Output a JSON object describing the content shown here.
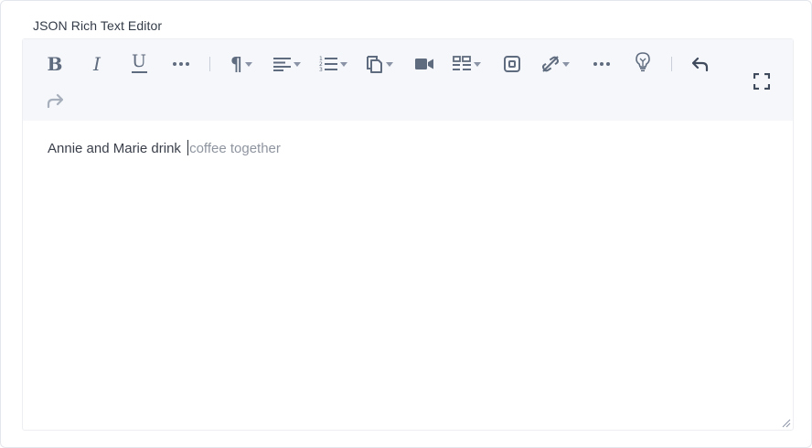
{
  "field": {
    "label": "JSON Rich Text Editor"
  },
  "toolbar": {
    "buttons": [
      {
        "name": "bold",
        "label": "B"
      },
      {
        "name": "italic",
        "label": "I"
      },
      {
        "name": "underline",
        "label": "U"
      },
      {
        "name": "more-formatting"
      },
      {
        "name": "paragraph-style"
      },
      {
        "name": "text-align"
      },
      {
        "name": "list"
      },
      {
        "name": "embed-asset"
      },
      {
        "name": "video"
      },
      {
        "name": "table"
      },
      {
        "name": "embed-block"
      },
      {
        "name": "link"
      },
      {
        "name": "more-options"
      },
      {
        "name": "ai-assistant"
      },
      {
        "name": "undo"
      },
      {
        "name": "redo"
      },
      {
        "name": "fullscreen"
      }
    ]
  },
  "content": {
    "typed_text": "Annie and Marie drink ",
    "suggestion_text": "coffee together"
  },
  "colors": {
    "icon": "#5f6b7e",
    "toolbar_bg": "#f5f7fa",
    "text": "#3a3f4a",
    "suggestion": "#8f959f"
  }
}
